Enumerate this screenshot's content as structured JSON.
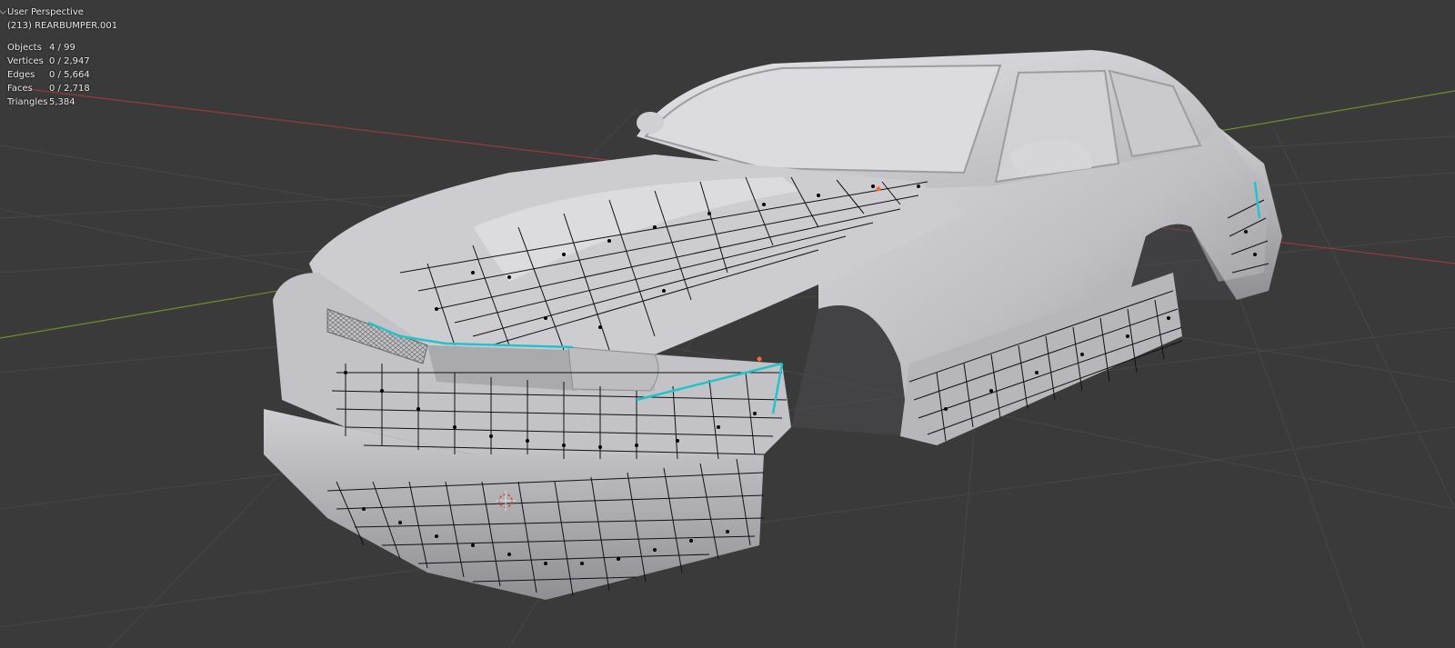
{
  "viewport": {
    "view_name": "User Perspective",
    "active_object": "(213) REARBUMPER.001"
  },
  "stats": [
    {
      "label": "Objects",
      "value": "4 / 99"
    },
    {
      "label": "Vertices",
      "value": "0 / 2,947"
    },
    {
      "label": "Edges",
      "value": "0 / 5,664"
    },
    {
      "label": "Faces",
      "value": "0 / 2,718"
    },
    {
      "label": "Triangles",
      "value": "5,384"
    }
  ],
  "colors": {
    "background": "#3a3a3a",
    "grid": "#474747",
    "axis_x": "#9a3a3a",
    "axis_y": "#6f8f2a",
    "body": "#c9c9cd",
    "wire": "#000000",
    "selected_edge": "#22c4cc"
  }
}
